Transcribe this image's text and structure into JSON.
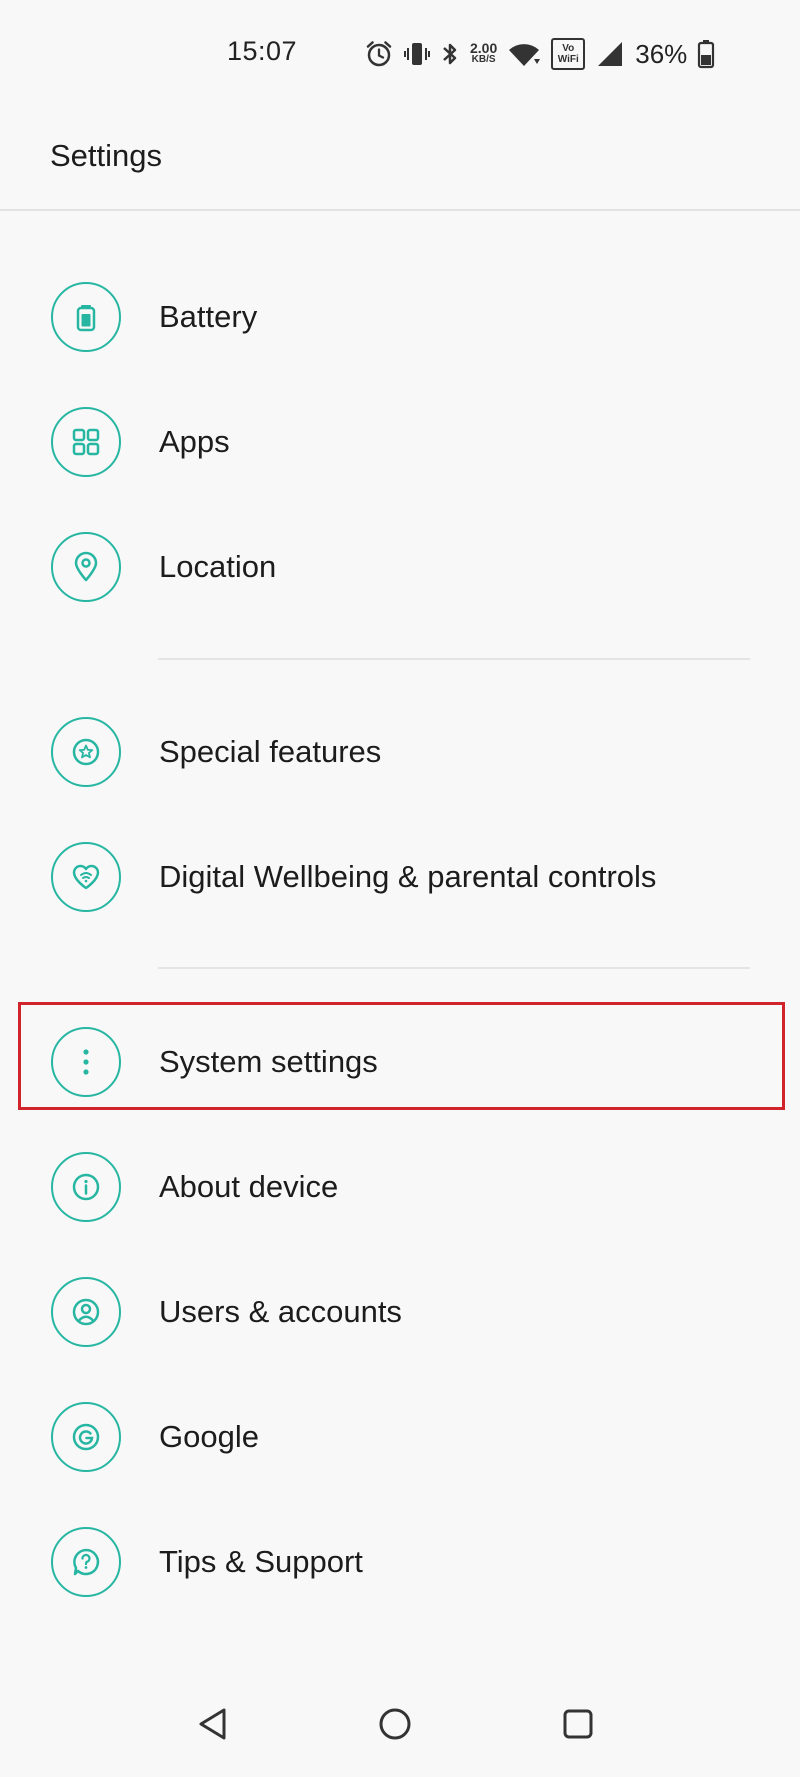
{
  "status_bar": {
    "time": "15:07",
    "speed_value": "2.00",
    "speed_unit": "KB/S",
    "vowifi_top": "Vo",
    "vowifi_bottom": "WiFi",
    "battery_percent": "36%",
    "icons": [
      "alarm-icon",
      "vibrate-icon",
      "bluetooth-icon",
      "wifi-icon",
      "cell-signal-icon",
      "battery-icon"
    ]
  },
  "app_bar": {
    "title": "Settings"
  },
  "settings": {
    "items": [
      {
        "label": "Battery",
        "icon": "battery-icon"
      },
      {
        "label": "Apps",
        "icon": "apps-grid-icon"
      },
      {
        "label": "Location",
        "icon": "location-pin-icon"
      },
      {
        "label": "Special features",
        "icon": "star-icon"
      },
      {
        "label": "Digital Wellbeing & parental controls",
        "icon": "heart-icon"
      },
      {
        "label": "System settings",
        "icon": "more-vertical-icon"
      },
      {
        "label": "About device",
        "icon": "info-icon"
      },
      {
        "label": "Users & accounts",
        "icon": "user-icon"
      },
      {
        "label": "Google",
        "icon": "google-icon"
      },
      {
        "label": "Tips & Support",
        "icon": "help-icon"
      }
    ],
    "highlighted_item": "System settings"
  },
  "colors": {
    "accent": "#27b6a2",
    "highlight_border": "#d0242a",
    "background": "#f8f8f8",
    "text": "#1c1c1c"
  },
  "nav_bar": {
    "buttons": [
      "back-icon",
      "home-icon",
      "recents-icon"
    ]
  }
}
